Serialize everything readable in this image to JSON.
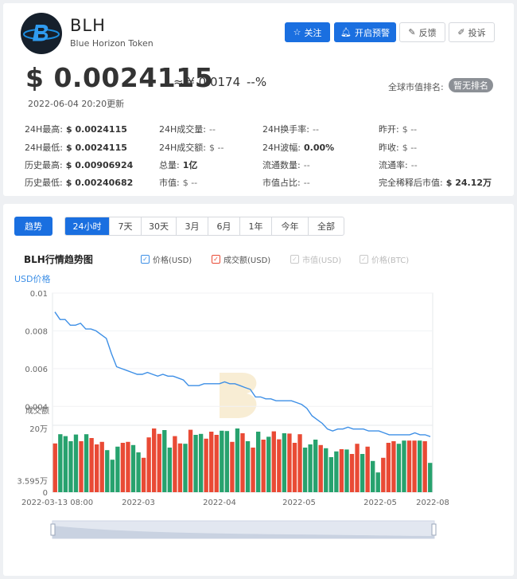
{
  "coin": {
    "symbol": "BLH",
    "name": "Blue Horizon Token"
  },
  "actions": {
    "follow": "关注",
    "alert": "开启预警",
    "feedback": "反馈",
    "complain": "投诉"
  },
  "price": {
    "usd": "$ 0.0024115",
    "cny": "≈ ¥ 0.0174",
    "change": "--%",
    "updated": "2022-06-04 20:20更新",
    "rank_label": "全球市值排名:",
    "rank_value": "暂无排名"
  },
  "stats": [
    {
      "label": "24H最高:",
      "value": "$ 0.0024115"
    },
    {
      "label": "24H成交量:",
      "value": "--"
    },
    {
      "label": "24H换手率:",
      "value": "--"
    },
    {
      "label": "昨开:",
      "value": "$ --"
    },
    {
      "label": "24H最低:",
      "value": "$ 0.0024115"
    },
    {
      "label": "24H成交额:",
      "value": "$ --"
    },
    {
      "label": "24H波幅:",
      "value": "0.00%"
    },
    {
      "label": "昨收:",
      "value": "$ --"
    },
    {
      "label": "历史最高:",
      "value": "$ 0.00906924"
    },
    {
      "label": "总量:",
      "value": "1亿"
    },
    {
      "label": "流通数量:",
      "value": "--"
    },
    {
      "label": "流通率:",
      "value": "--"
    },
    {
      "label": "历史最低:",
      "value": "$ 0.00240682"
    },
    {
      "label": "市值:",
      "value": "$ --"
    },
    {
      "label": "市值占比:",
      "value": "--"
    },
    {
      "label": "完全稀释后市值:",
      "value": "$ 24.12万"
    }
  ],
  "tabs": {
    "trend": "趋势",
    "ranges": [
      "24小时",
      "7天",
      "30天",
      "3月",
      "6月",
      "1年",
      "今年",
      "全部"
    ],
    "active_range": "24小时"
  },
  "chart_header": {
    "title": "BLH行情趋势图",
    "legend": [
      {
        "label": "价格(USD)",
        "checked": true,
        "color": "#3d8fe6"
      },
      {
        "label": "成交额(USD)",
        "checked": true,
        "color": "#e94a35"
      },
      {
        "label": "市值(USD)",
        "checked": false,
        "color": "#c8c8c8"
      },
      {
        "label": "价格(BTC)",
        "checked": false,
        "color": "#c8c8c8"
      }
    ]
  },
  "colors": {
    "accent": "#1a6fe0",
    "price_line": "#3d8fe6",
    "volume_up": "#e94a35",
    "volume_down": "#27a26e"
  },
  "chart_data": {
    "type": "line",
    "price_axis_label": "USD价格",
    "volume_axis_label": "成交额",
    "price_ticks": [
      "0.01",
      "0.008",
      "0.006",
      "0.004"
    ],
    "volume_ticks": [
      "20万",
      "3.595万",
      "0"
    ],
    "x_ticks": [
      "2022-03-13 08:00",
      "2022-03",
      "2022-04",
      "2022-05",
      "2022-05",
      "2022-08"
    ],
    "price_ylim": [
      0.003,
      0.01
    ],
    "volume_ylim": [
      0,
      200000
    ],
    "price": [
      0.009,
      0.0086,
      0.0086,
      0.0083,
      0.0083,
      0.0084,
      0.0081,
      0.0081,
      0.008,
      0.0078,
      0.0076,
      0.0068,
      0.0061,
      0.006,
      0.0059,
      0.0058,
      0.0057,
      0.0057,
      0.0058,
      0.0057,
      0.0056,
      0.0057,
      0.0056,
      0.0056,
      0.0055,
      0.0054,
      0.0051,
      0.0051,
      0.0051,
      0.0052,
      0.0052,
      0.0052,
      0.0052,
      0.0053,
      0.0052,
      0.0052,
      0.0051,
      0.005,
      0.0049,
      0.0045,
      0.0045,
      0.0044,
      0.0044,
      0.0043,
      0.0043,
      0.0043,
      0.0043,
      0.0042,
      0.0041,
      0.0039,
      0.0035,
      0.0033,
      0.0031,
      0.0028,
      0.0027,
      0.0028,
      0.0028,
      0.0029,
      0.0028,
      0.0028,
      0.0028,
      0.0027,
      0.0027,
      0.0027,
      0.0026,
      0.0025,
      0.0025,
      0.0025,
      0.0025,
      0.0025,
      0.0026,
      0.0025,
      0.0025,
      0.0024
    ],
    "volume": [
      {
        "v": 153000,
        "up": true
      },
      {
        "v": 182000,
        "up": false
      },
      {
        "v": 176000,
        "up": false
      },
      {
        "v": 160000,
        "up": false
      },
      {
        "v": 181000,
        "up": false
      },
      {
        "v": 160000,
        "up": true
      },
      {
        "v": 182000,
        "up": false
      },
      {
        "v": 170000,
        "up": true
      },
      {
        "v": 150000,
        "up": true
      },
      {
        "v": 158000,
        "up": true
      },
      {
        "v": 132000,
        "up": false
      },
      {
        "v": 102000,
        "up": false
      },
      {
        "v": 143000,
        "up": false
      },
      {
        "v": 155000,
        "up": true
      },
      {
        "v": 158000,
        "up": true
      },
      {
        "v": 148000,
        "up": false
      },
      {
        "v": 125000,
        "up": false
      },
      {
        "v": 108000,
        "up": true
      },
      {
        "v": 172000,
        "up": true
      },
      {
        "v": 200000,
        "up": true
      },
      {
        "v": 183000,
        "up": true
      },
      {
        "v": 195000,
        "up": false
      },
      {
        "v": 140000,
        "up": false
      },
      {
        "v": 176000,
        "up": true
      },
      {
        "v": 153000,
        "up": true
      },
      {
        "v": 152000,
        "up": false
      },
      {
        "v": 196000,
        "up": true
      },
      {
        "v": 180000,
        "up": false
      },
      {
        "v": 183000,
        "up": false
      },
      {
        "v": 168000,
        "up": true
      },
      {
        "v": 190000,
        "up": true
      },
      {
        "v": 180000,
        "up": true
      },
      {
        "v": 193000,
        "up": false
      },
      {
        "v": 192000,
        "up": false
      },
      {
        "v": 158000,
        "up": true
      },
      {
        "v": 200000,
        "up": false
      },
      {
        "v": 185000,
        "up": true
      },
      {
        "v": 160000,
        "up": false
      },
      {
        "v": 140000,
        "up": true
      },
      {
        "v": 190000,
        "up": false
      },
      {
        "v": 165000,
        "up": true
      },
      {
        "v": 174000,
        "up": false
      },
      {
        "v": 191000,
        "up": true
      },
      {
        "v": 166000,
        "up": true
      },
      {
        "v": 185000,
        "up": false
      },
      {
        "v": 184000,
        "up": true
      },
      {
        "v": 155000,
        "up": true
      },
      {
        "v": 182000,
        "up": true
      },
      {
        "v": 140000,
        "up": false
      },
      {
        "v": 150000,
        "up": false
      },
      {
        "v": 165000,
        "up": false
      },
      {
        "v": 148000,
        "up": true
      },
      {
        "v": 138000,
        "up": false
      },
      {
        "v": 110000,
        "up": false
      },
      {
        "v": 128000,
        "up": false
      },
      {
        "v": 135000,
        "up": true
      },
      {
        "v": 134000,
        "up": false
      },
      {
        "v": 120000,
        "up": true
      },
      {
        "v": 152000,
        "up": true
      },
      {
        "v": 120000,
        "up": false
      },
      {
        "v": 143000,
        "up": true
      },
      {
        "v": 98000,
        "up": false
      },
      {
        "v": 62000,
        "up": false
      },
      {
        "v": 108000,
        "up": true
      },
      {
        "v": 155000,
        "up": true
      },
      {
        "v": 160000,
        "up": true
      },
      {
        "v": 152000,
        "up": false
      },
      {
        "v": 162000,
        "up": false
      },
      {
        "v": 162000,
        "up": true
      },
      {
        "v": 162000,
        "up": true
      },
      {
        "v": 162000,
        "up": false
      },
      {
        "v": 160000,
        "up": true
      },
      {
        "v": 92000,
        "up": false
      }
    ]
  }
}
